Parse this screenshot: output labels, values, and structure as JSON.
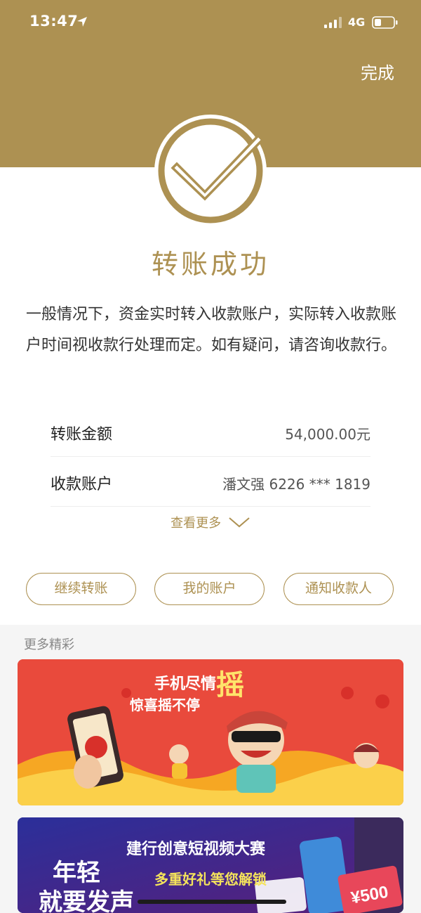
{
  "status_bar": {
    "time": "13:47",
    "network": "4G"
  },
  "header": {
    "done_label": "完成",
    "accent_color": "#ad9152"
  },
  "result": {
    "title": "转账成功",
    "notice": "一般情况下，资金实时转入收款账户，实际转入收款账户时间视收款行处理而定。如有疑问，请咨询收款行。"
  },
  "details": {
    "amount_label": "转账金额",
    "amount_value": "54,000.00元",
    "payee_label": "收款账户",
    "payee_value": "潘文强 6226 *** 1819",
    "view_more_label": "查看更多"
  },
  "actions": {
    "continue_label": "继续转账",
    "account_label": "我的账户",
    "notify_label": "通知收款人"
  },
  "more": {
    "section_title": "更多精彩",
    "banner1": {
      "headline": "手机尽情",
      "big_char": "摇",
      "subline": "惊喜摇不停"
    },
    "banner2": {
      "headline": "建行创意短视频大赛",
      "subline": "多重好礼等您解锁",
      "big_text_1": "年轻",
      "big_text_2": "就要发声",
      "price": "¥500"
    }
  }
}
